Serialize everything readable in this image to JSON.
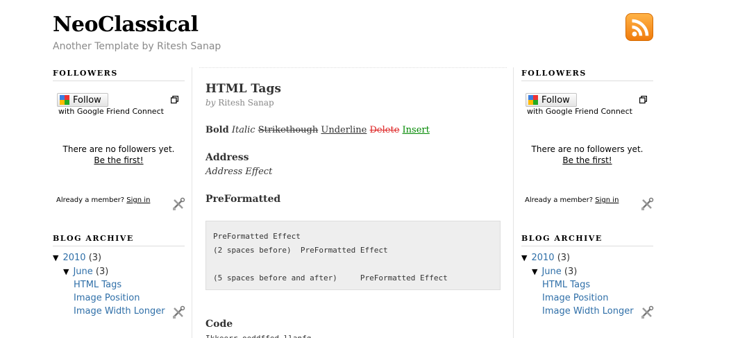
{
  "header": {
    "title": "NeoClassical",
    "description": "Another Template by Ritesh Sanap"
  },
  "post": {
    "title": "HTML Tags",
    "byline_prefix": "by",
    "author": "Ritesh Sanap",
    "formatting": {
      "bold": "Bold",
      "italic": "Italic",
      "strike": "Strikethough",
      "underline": "Underline",
      "delete": "Delete",
      "insert": "Insert"
    },
    "address_heading": "Address",
    "address_text": "Address Effect",
    "preformatted_heading": "PreFormatted",
    "preformatted_text": "PreFormatted Effect\n(2 spaces before)  PreFormatted Effect\n\n(5 spaces before and after)     PreFormatted Effect",
    "code_heading": "Code",
    "code_text": "Ikkeerr oeddffed llanfg"
  },
  "sidebar": {
    "followers_heading": "FOLLOWERS",
    "follow_label": "Follow",
    "gfc_text": "with Google Friend Connect",
    "no_followers": "There are no followers yet.",
    "be_first": "Be the first!",
    "member_prefix": "Already a member?",
    "sign_in": "Sign in",
    "archive_heading": "BLOG ARCHIVE",
    "archive_year": "2010",
    "archive_year_count": "(3)",
    "archive_month": "June",
    "archive_month_count": "(3)",
    "archive_posts": [
      "HTML Tags",
      "Image Position",
      "Image Width Longer"
    ]
  },
  "colors": {
    "link": "#2f6fa8",
    "delete": "#dd2222",
    "insert": "#008800",
    "rss": "#f7931e"
  },
  "icons": [
    "rss-icon",
    "google-icon",
    "popout-icon",
    "tools-icon",
    "triangle-down-icon"
  ]
}
